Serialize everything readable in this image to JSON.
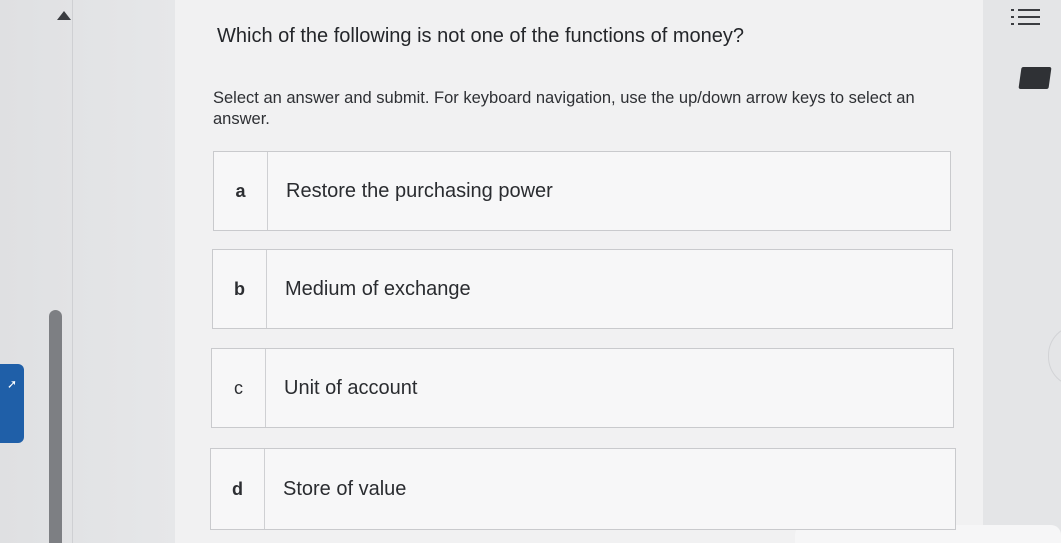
{
  "question": {
    "text": "Which of the following is not one of the functions of money?",
    "instructions": "Select an answer and submit. For keyboard navigation, use the up/down arrow keys to select an answer."
  },
  "options": [
    {
      "letter": "a",
      "text": "Restore the purchasing power"
    },
    {
      "letter": "b",
      "text": "Medium of exchange"
    },
    {
      "letter": "c",
      "text": "Unit of account"
    },
    {
      "letter": "d",
      "text": "Store of value"
    }
  ],
  "icons": {
    "scroll_up": "triangle-up-icon",
    "menu": "list-menu-icon",
    "bookmark": "bookmark-icon",
    "side_tab": "expand-arrow-icon"
  },
  "colors": {
    "accent": "#1f5fa8"
  }
}
